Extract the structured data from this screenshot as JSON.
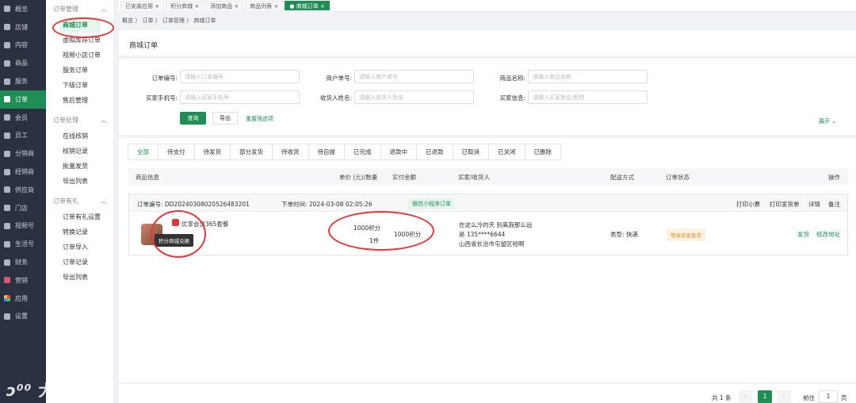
{
  "nav": [
    "概览",
    "店铺",
    "内容",
    "商品",
    "服务",
    "订单",
    "会员",
    "员工",
    "分销商",
    "经销商",
    "供应商",
    "门店",
    "视频号",
    "生活号",
    "财务",
    "营销",
    "应用",
    "设置"
  ],
  "sub": {
    "g1": "订单管理",
    "g1_items": [
      "商城订单",
      "虚拟库存订单",
      "视频小店订单",
      "服务订单",
      "下级订单",
      "售后管理"
    ],
    "g2": "订单处理",
    "g2_items": [
      "在线核销",
      "核销记录",
      "批量发货",
      "导出列表"
    ],
    "g3": "订单有礼",
    "g3_items": [
      "订单有礼设置",
      "转换记录",
      "订单导入",
      "订单记录",
      "导出列表"
    ]
  },
  "tabs": [
    "已安装应用",
    "积分商城",
    "添加商品",
    "商品列表",
    "商城订单"
  ],
  "breadcrumb": "概览 〉 订单 〉 订单管理 〉 商城订单",
  "title": "商城订单",
  "filters": {
    "order_no": "订单编号:",
    "order_no_ph": "请输入订单编号",
    "merchant_no": "商户单号:",
    "merchant_no_ph": "请输入商户单号",
    "goods": "商品名称:",
    "goods_ph": "请输入商品名称",
    "phone": "买家手机号:",
    "phone_ph": "请输入买家手机号",
    "receiver": "收货人姓名:",
    "receiver_ph": "请输入收货人姓名",
    "buyer": "买家信息:",
    "buyer_ph": "请输入买家姓名/昵称",
    "query": "查询",
    "export": "导出",
    "reset": "重置筛选项",
    "expand": "展开 ⌄"
  },
  "status_tabs": [
    "全部",
    "待支付",
    "待发货",
    "部分发货",
    "待收货",
    "待自提",
    "已完成",
    "退款中",
    "已退款",
    "已取消",
    "已关闭",
    "已删除"
  ],
  "columns": {
    "info": "商品信息",
    "price": "单价 (元)/数量",
    "paid": "实付金额",
    "buyer": "买家/收货人",
    "ship": "配送方式",
    "status": "订单状态",
    "ops": "操作"
  },
  "order": {
    "no": "订单编号: DD20240308020526483201",
    "time": "下单时间: 2024-03-08 02:05:26",
    "source": "微信小程序订单",
    "print1": "打印小票",
    "print2": "打印发货单",
    "detail": "详情",
    "remark": "备注",
    "goods": "优享会员365套餐",
    "tooltip": "积分商城兑换",
    "price": "1000积分",
    "qty": "1件",
    "paid": "1000积分",
    "name": "在这么冷的天 别离我那么远",
    "phone": "是 135****6644",
    "addr": "山西省长治市屯留区哈啊",
    "ship": "类型: 快递",
    "status": "等待卖家发货",
    "ship_btn": "发货",
    "edit_btn": "修改地址"
  },
  "pager": {
    "total": "共 1 条",
    "prev": "‹",
    "page": "1",
    "next": "›",
    "goto": "前往",
    "page_input": "1",
    "unit": "页"
  },
  "watermark": "大数跨境"
}
